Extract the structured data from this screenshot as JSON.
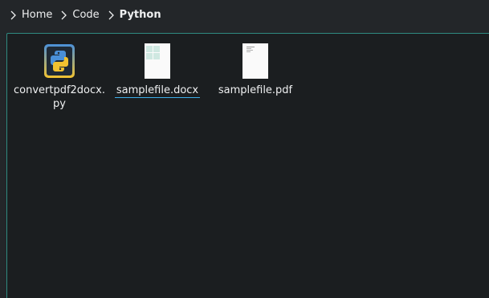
{
  "breadcrumb": {
    "items": [
      {
        "label": "Home"
      },
      {
        "label": "Code"
      },
      {
        "label": "Python",
        "current": true
      }
    ]
  },
  "files": [
    {
      "name": "convertpdf2docx.py",
      "icon": "python-file-icon"
    },
    {
      "name": "samplefile.docx",
      "icon": "docx-thumbnail-icon",
      "focused": true
    },
    {
      "name": "samplefile.pdf",
      "icon": "pdf-thumbnail-icon"
    }
  ],
  "colors": {
    "window_bg": "#232629",
    "view_bg": "#1b1e20",
    "view_border": "#2f8a80",
    "text": "#eff0f1",
    "focus_underline": "#3daee9"
  }
}
